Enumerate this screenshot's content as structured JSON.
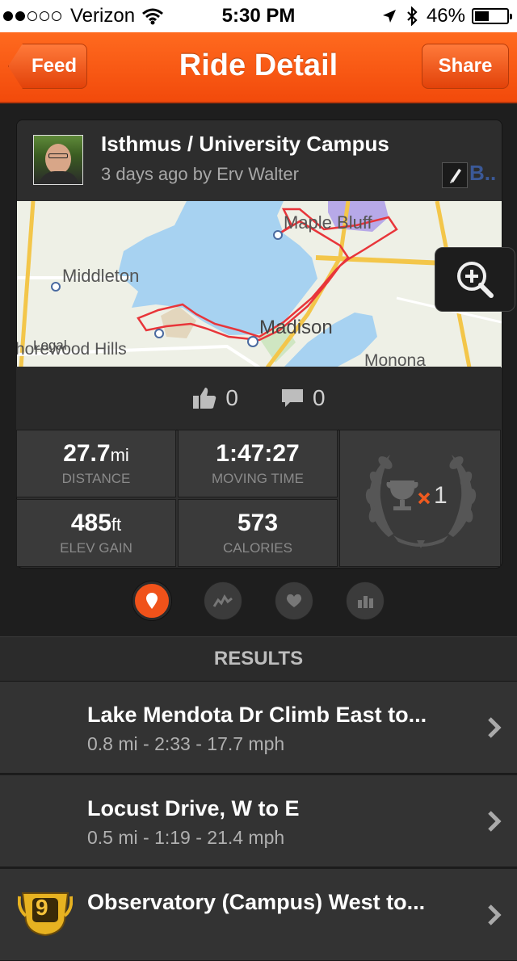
{
  "status_bar": {
    "carrier": "Verizon",
    "time": "5:30 PM",
    "battery": "46%",
    "battery_level": 0.46,
    "signal_bars": 2
  },
  "nav": {
    "back_label": "Feed",
    "title": "Ride Detail",
    "share_label": "Share"
  },
  "ride": {
    "title": "Isthmus / University Campus",
    "subtitle": "3 days ago by Erv Walter",
    "fb_label": "B.."
  },
  "map": {
    "labels": {
      "maple_bluff": "Maple Bluff",
      "middleton": "Middleton",
      "madison": "Madison",
      "legal": "Legal",
      "shorewood": "horewood Hills",
      "monona": "Monona"
    }
  },
  "social": {
    "kudos": "0",
    "comments": "0"
  },
  "stats": {
    "distance_value": "27.7",
    "distance_unit": "mi",
    "distance_label": "DISTANCE",
    "time_value": "1:47:27",
    "time_label": "MOVING TIME",
    "elev_value": "485",
    "elev_unit": "ft",
    "elev_label": "ELEV GAIN",
    "cal_value": "573",
    "cal_label": "CALORIES",
    "achievements": "1"
  },
  "results": {
    "heading": "RESULTS",
    "items": [
      {
        "title": "Lake Mendota Dr Climb East to...",
        "detail": "0.8 mi - 2:33 - 17.7 mph"
      },
      {
        "title": "Locust Drive, W to E",
        "detail": "0.5 mi - 1:19 - 21.4 mph"
      },
      {
        "title": "Observatory (Campus) West to...",
        "detail": "",
        "rank": "9"
      }
    ]
  },
  "colors": {
    "accent": "#f24a0b",
    "map_water": "#a7d2f1",
    "route": "#e8353a"
  }
}
